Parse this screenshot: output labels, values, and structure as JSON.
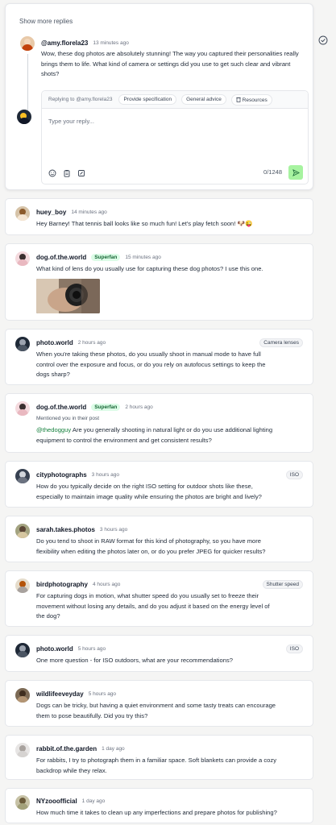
{
  "thread": {
    "show_more": "Show more replies",
    "main_comment": {
      "user": "@amy.florela23",
      "time": "13 minutes ago",
      "text_lines": [
        "Wow, these dog photos are absolutely stunning! The way you captured their personalities really",
        "brings them to life. What kind of camera or settings did you use to get such clear and vibrant",
        "shots?"
      ]
    },
    "reply_box": {
      "replying_to": "Replying to @amy.florela23",
      "chips": [
        "Provide specification",
        "General advice",
        "Resources"
      ],
      "placeholder": "Type your reply...",
      "counter": "0/1248",
      "tools": [
        "emoji-icon",
        "clipboard-icon",
        "edit-icon"
      ]
    }
  },
  "comments": [
    {
      "user": "huey_boy",
      "time": "14 minutes ago",
      "lines": [
        "Hey Barney! That tennis ball looks like so much fun! Let's play fetch soon! 🐶😜"
      ]
    },
    {
      "user": "dog.of.the.world",
      "badge": "Superfan",
      "time": "15 minutes ago",
      "lines": [
        "What kind of lens do you usually use for capturing these dog photos? I use this one."
      ]
    },
    {
      "user": "photo.world",
      "time": "2 hours ago",
      "tag": "Camera lenses",
      "lines": [
        "When you're taking these photos, do you usually shoot in manual mode to have full",
        "control over the exposure and focus, or do you rely on autofocus settings to keep the",
        "dogs sharp?"
      ]
    },
    {
      "user": "dog.of.the.world",
      "badge": "Superfan",
      "time": "2 hours ago",
      "note": "Mentioned you in their post",
      "mention": "@thedogguy",
      "lines": [
        " Are you generally shooting in natural light or do you use additional lighting",
        "equipment to control the environment and get consistent results?"
      ]
    },
    {
      "user": "cityphotographs",
      "time": "3 hours ago",
      "tag": "ISO",
      "lines": [
        "How do you typically decide on the right ISO setting for outdoor shots like these,",
        "especially to maintain image quality while ensuring the photos are bright and lively?"
      ]
    },
    {
      "user": "sarah.takes.photos",
      "time": "3 hours ago",
      "lines": [
        "Do you tend to shoot in RAW format for this kind of photography, so you have more",
        "flexibility when editing the photos later on, or do you prefer JPEG for quicker results?"
      ]
    },
    {
      "user": "birdphotography",
      "time": "4 hours ago",
      "tag": "Shutter speed",
      "lines": [
        "For capturing dogs in motion, what shutter speed do you usually set to freeze their",
        "movement without losing any details, and do you adjust it based on the energy level of",
        "the dog?"
      ]
    },
    {
      "user": "photo.world",
      "time": "5 hours ago",
      "tag": "ISO",
      "lines": [
        "One more question - for ISO outdoors, what are your recommendations?"
      ]
    },
    {
      "user": "wildlifeeveyday",
      "time": "5 hours ago",
      "lines": [
        "Dogs can be tricky, but having a quiet environment and some tasty treats can encourage",
        "them to pose beautifully. Did you try this?"
      ]
    },
    {
      "user": "rabbit.of.the.garden",
      "time": "1 day ago",
      "lines": [
        "For rabbits, I try to photograph them in a familiar space. Soft blankets can provide a cozy",
        "backdrop while they relax."
      ]
    },
    {
      "user": "NYzooofficial",
      "time": "1 day ago",
      "lines": [
        "How much time it takes to clean up any imperfections and prepare photos for publishing?"
      ]
    }
  ],
  "colors": {
    "accent_green": "#22c55e",
    "send_bg": "#a7f3a0",
    "superfan_bg": "#dcfce7"
  }
}
